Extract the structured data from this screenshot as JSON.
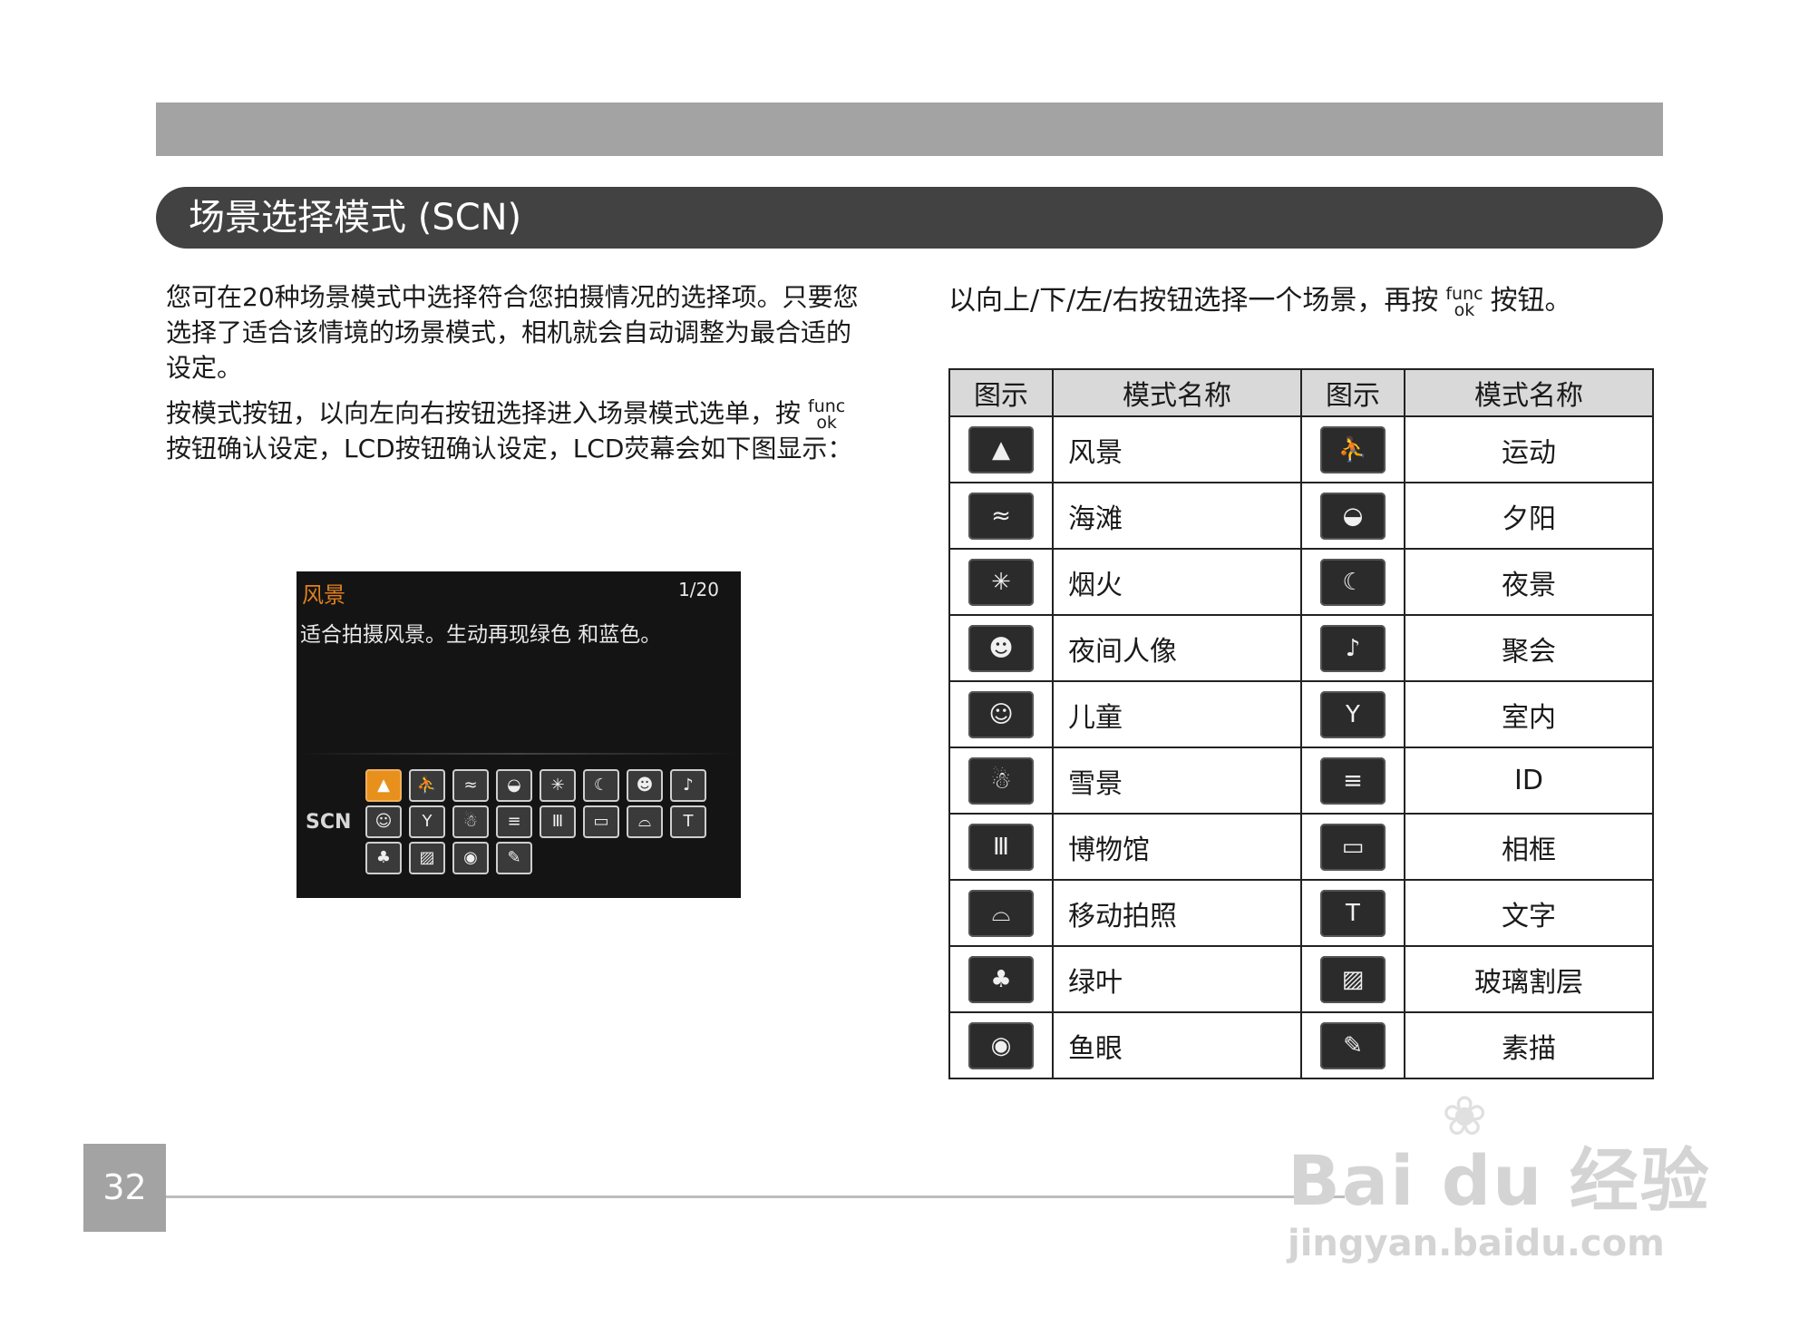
{
  "header": {
    "title": "场景选择模式 (SCN)"
  },
  "left": {
    "para1": "您可在20种场景模式中选择符合您拍摄情况的选择项。只要您选择了适合该情境的场景模式，相机就会自动调整为最合适的设定。",
    "para2_a": "按模式按钮，以向左向右按钮选择进入场景模式选单，按",
    "para2_b": "按钮确认设定，LCD按钮确认设定，LCD荧幕会如下图显示：",
    "func": "func",
    "ok": "ok"
  },
  "camera_screen": {
    "mode": "风景",
    "page": "1/20",
    "description": "适合拍摄风景。生动再现绿色 和蓝色。",
    "scn_label": "SCN"
  },
  "right": {
    "instruction_a": "以向上/下/左/右按钮选择一个场景，再按",
    "instruction_b": "按钮。",
    "func": "func",
    "ok": "ok"
  },
  "table": {
    "headers": [
      "图示",
      "模式名称",
      "图示",
      "模式名称"
    ],
    "rows": [
      {
        "icon1": "landscape-icon",
        "name1": "风景",
        "icon2": "sport-icon",
        "name2": "运动"
      },
      {
        "icon1": "beach-icon",
        "name1": "海滩",
        "icon2": "sunset-icon",
        "name2": "夕阳"
      },
      {
        "icon1": "fireworks-icon",
        "name1": "烟火",
        "icon2": "night-scene-icon",
        "name2": "夜景"
      },
      {
        "icon1": "night-portrait-icon",
        "name1": "夜间人像",
        "icon2": "party-icon",
        "name2": "聚会"
      },
      {
        "icon1": "kids-icon",
        "name1": "儿童",
        "icon2": "indoor-icon",
        "name2": "室内"
      },
      {
        "icon1": "snow-icon",
        "name1": "雪景",
        "icon2": "id-icon",
        "name2": "ID"
      },
      {
        "icon1": "museum-icon",
        "name1": "博物馆",
        "icon2": "frame-icon",
        "name2": "相框"
      },
      {
        "icon1": "panning-icon",
        "name1": "移动拍照",
        "icon2": "text-icon",
        "name2": "文字"
      },
      {
        "icon1": "foliage-icon",
        "name1": "绿叶",
        "icon2": "glass-icon",
        "name2": "玻璃割层"
      },
      {
        "icon1": "fisheye-icon",
        "name1": "鱼眼",
        "icon2": "sketch-icon",
        "name2": "素描"
      }
    ]
  },
  "footer": {
    "page_number": "32"
  },
  "watermark": {
    "brand": "Bai du 经验",
    "url": "jingyan.baidu.com"
  }
}
